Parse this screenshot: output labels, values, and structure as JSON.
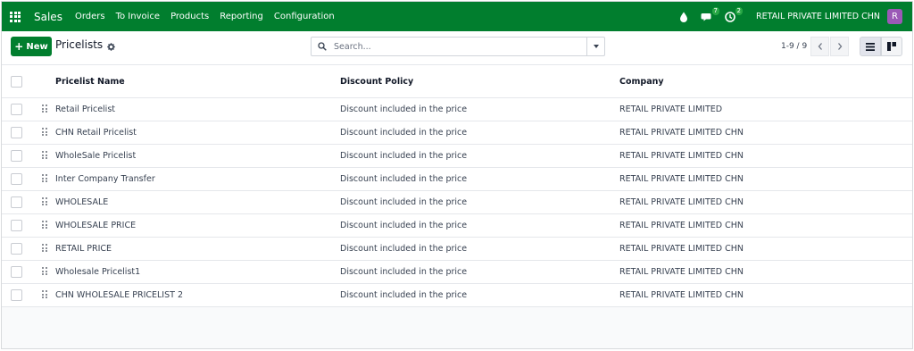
{
  "navbar": {
    "app_name": "Sales",
    "menu": [
      "Orders",
      "To Invoice",
      "Products",
      "Reporting",
      "Configuration"
    ],
    "messages_badge": "7",
    "activities_badge": "2",
    "company": "RETAIL PRIVATE LIMITED CHN",
    "avatar_initial": "R",
    "colors": {
      "bar": "#017e2e",
      "avatar": "#9b59b6"
    }
  },
  "control_panel": {
    "new_label": "New",
    "breadcrumb": "Pricelists",
    "search_placeholder": "Search...",
    "pager": "1-9 / 9"
  },
  "table": {
    "columns": [
      "Pricelist Name",
      "Discount Policy",
      "Company"
    ],
    "rows": [
      {
        "name": "Retail Pricelist",
        "policy": "Discount included in the price",
        "company": "RETAIL PRIVATE LIMITED"
      },
      {
        "name": "CHN Retail Pricelist",
        "policy": "Discount included in the price",
        "company": "RETAIL PRIVATE LIMITED CHN"
      },
      {
        "name": "WholeSale Pricelist",
        "policy": "Discount included in the price",
        "company": "RETAIL PRIVATE LIMITED CHN"
      },
      {
        "name": "Inter Company Transfer",
        "policy": "Discount included in the price",
        "company": "RETAIL PRIVATE LIMITED CHN"
      },
      {
        "name": "WHOLESALE",
        "policy": "Discount included in the price",
        "company": "RETAIL PRIVATE LIMITED CHN"
      },
      {
        "name": "WHOLESALE PRICE",
        "policy": "Discount included in the price",
        "company": "RETAIL PRIVATE LIMITED CHN"
      },
      {
        "name": "RETAIL PRICE",
        "policy": "Discount included in the price",
        "company": "RETAIL PRIVATE LIMITED CHN"
      },
      {
        "name": "Wholesale Pricelist1",
        "policy": "Discount included in the price",
        "company": "RETAIL PRIVATE LIMITED CHN"
      },
      {
        "name": "CHN WHOLESALE PRICELIST 2",
        "policy": "Discount included in the price",
        "company": "RETAIL PRIVATE LIMITED CHN"
      }
    ]
  }
}
